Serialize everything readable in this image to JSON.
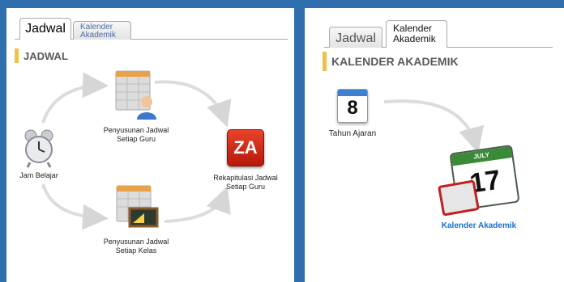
{
  "left": {
    "tabs": [
      {
        "label": "Jadwal",
        "active": true
      },
      {
        "label_line1": "Kalender",
        "label_line2": "Akademik",
        "active": false
      }
    ],
    "section_title": "JADWAL",
    "items": {
      "jam_belajar": {
        "label": "Jam Belajar",
        "icon": "alarm-clock-icon"
      },
      "guru": {
        "label_line1": "Penyusunan Jadwal",
        "label_line2": "Setiap Guru",
        "icon": "schedule-teacher-icon"
      },
      "kelas": {
        "label_line1": "Penyusunan Jadwal",
        "label_line2": "Setiap Kelas",
        "icon": "schedule-class-icon"
      },
      "rekap": {
        "label_line1": "Rekapitulasi Jadwal",
        "label_line2": "Setiap Guru",
        "icon": "za-summary-icon",
        "icon_text": "ZA"
      }
    }
  },
  "right": {
    "tabs": [
      {
        "label": "Jadwal",
        "active": false
      },
      {
        "label_line1": "Kalender",
        "label_line2": "Akademik",
        "active": true
      }
    ],
    "section_title": "KALENDER AKADEMIK",
    "items": {
      "tahun": {
        "label": "Tahun Ajaran",
        "icon": "calendar-day-icon",
        "icon_text": "8"
      },
      "kalender": {
        "label": "Kalender Akademik",
        "icon": "calendar-date-icon",
        "icon_month": "JULY",
        "icon_text": "17"
      }
    }
  },
  "colors": {
    "background": "#2f6fad",
    "accent_bar": "#f0c048",
    "link": "#1a6fcf",
    "arrow": "#d6d6d6"
  }
}
